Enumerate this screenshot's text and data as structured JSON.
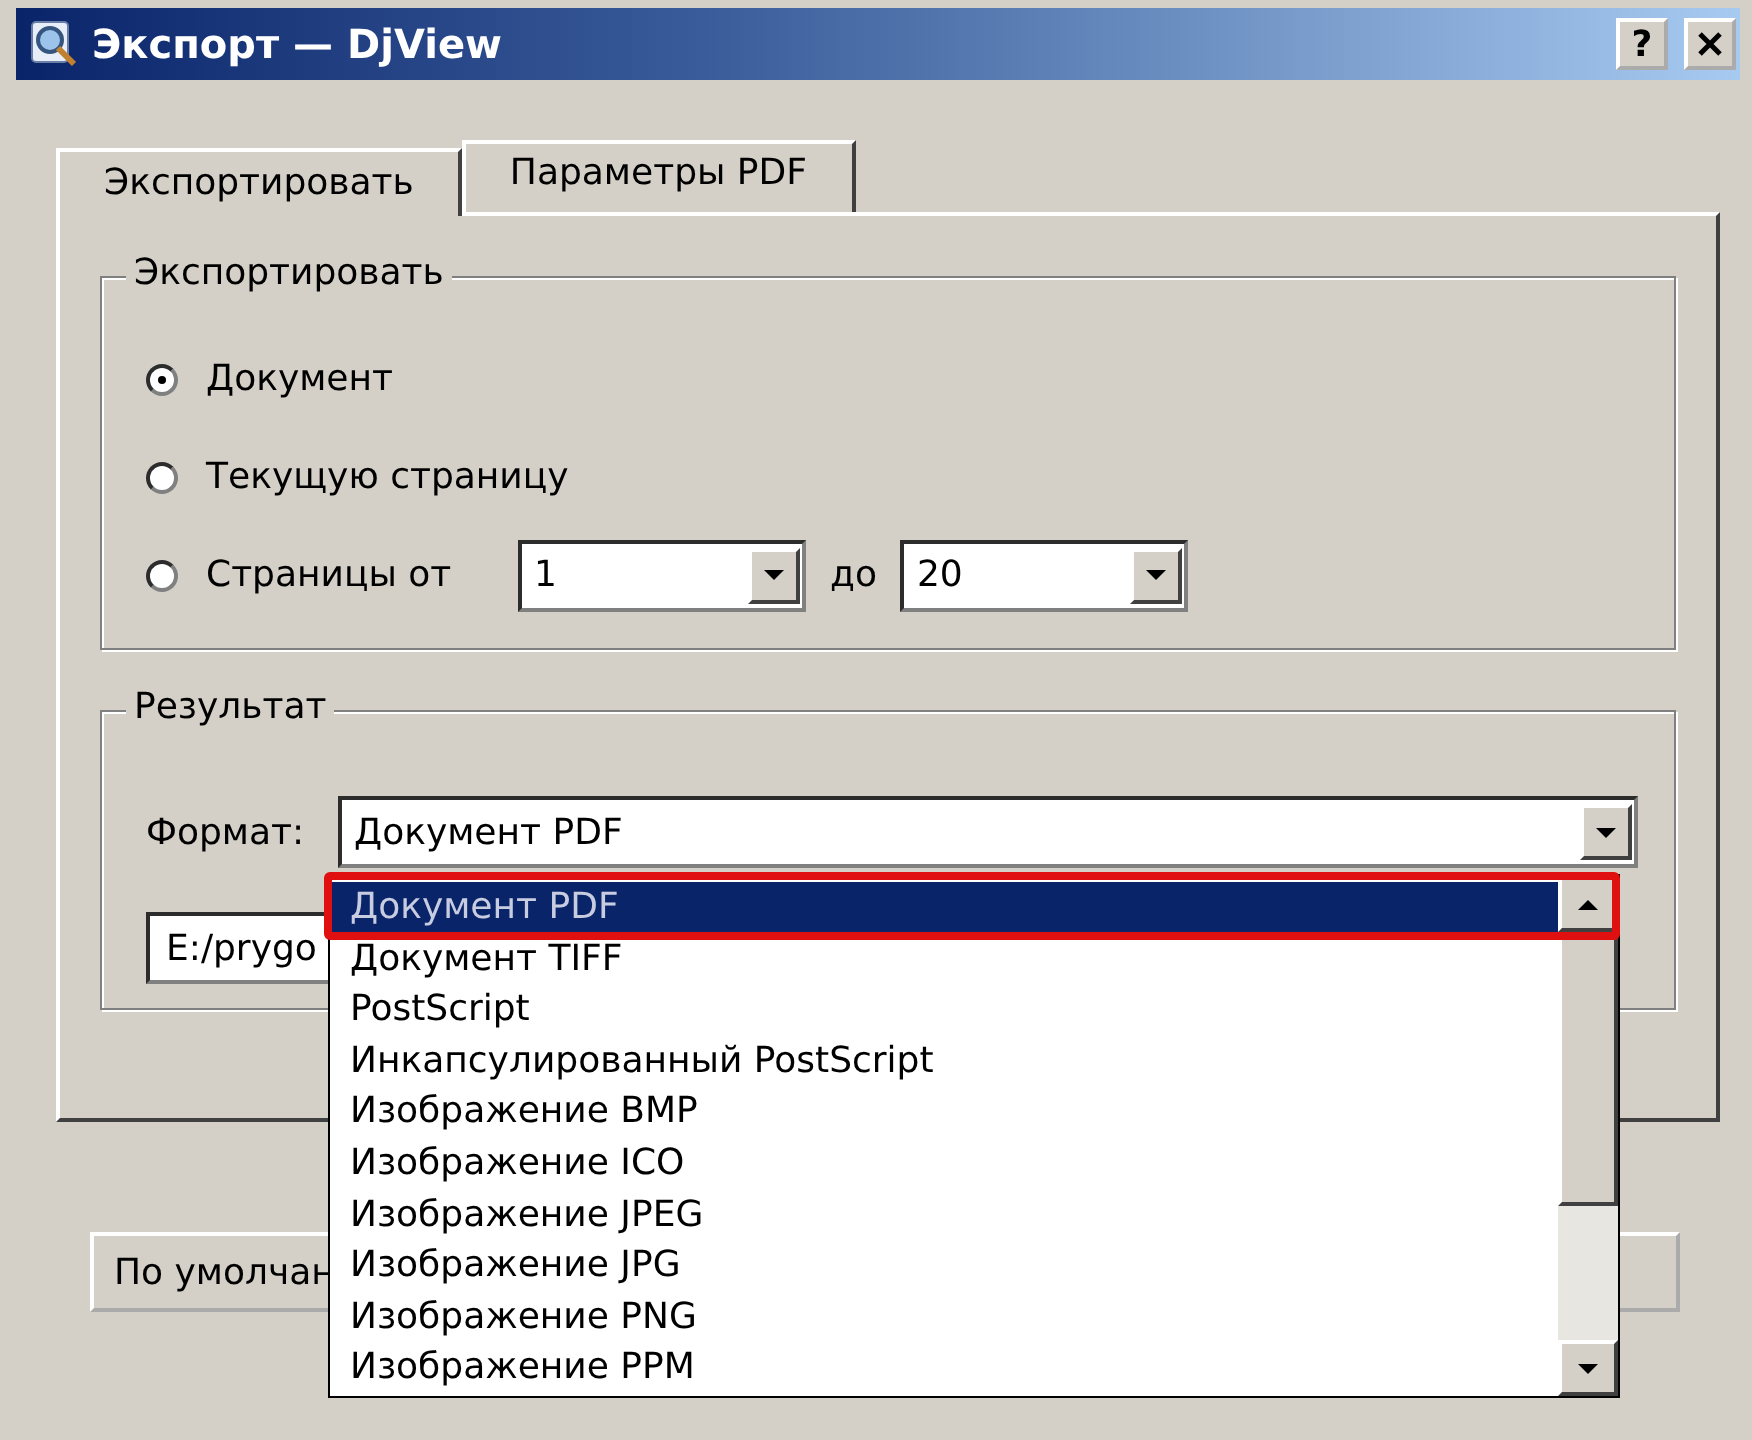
{
  "window": {
    "title": "Экспорт — DjView",
    "help_button": "?"
  },
  "tabs": [
    {
      "label": "Экспортировать",
      "selected": true
    },
    {
      "label": "Параметры PDF",
      "selected": false
    }
  ],
  "export_group": {
    "title": "Экспортировать",
    "options": [
      {
        "label": "Документ",
        "selected": true
      },
      {
        "label": "Текущую страницу",
        "selected": false
      },
      {
        "label": "Страницы от",
        "selected": false
      }
    ],
    "range": {
      "from_value": "1",
      "to_label": "до",
      "to_value": "20"
    }
  },
  "result_group": {
    "title": "Результат",
    "format_label": "Формат:",
    "format_value": "Документ PDF",
    "path_value": "E:/prygo"
  },
  "buttons": [
    {
      "label": "По умолчан"
    }
  ],
  "format_list": {
    "items": [
      {
        "label": "Документ PDF",
        "selected": true
      },
      {
        "label": "Документ TIFF",
        "selected": false
      },
      {
        "label": "PostScript",
        "selected": false
      },
      {
        "label": "Инкапсулированный PostScript",
        "selected": false
      },
      {
        "label": "Изображение BMP",
        "selected": false
      },
      {
        "label": "Изображение ICO",
        "selected": false
      },
      {
        "label": "Изображение JPEG",
        "selected": false
      },
      {
        "label": "Изображение JPG",
        "selected": false
      },
      {
        "label": "Изображение PNG",
        "selected": false
      },
      {
        "label": "Изображение PPM",
        "selected": false
      }
    ]
  }
}
